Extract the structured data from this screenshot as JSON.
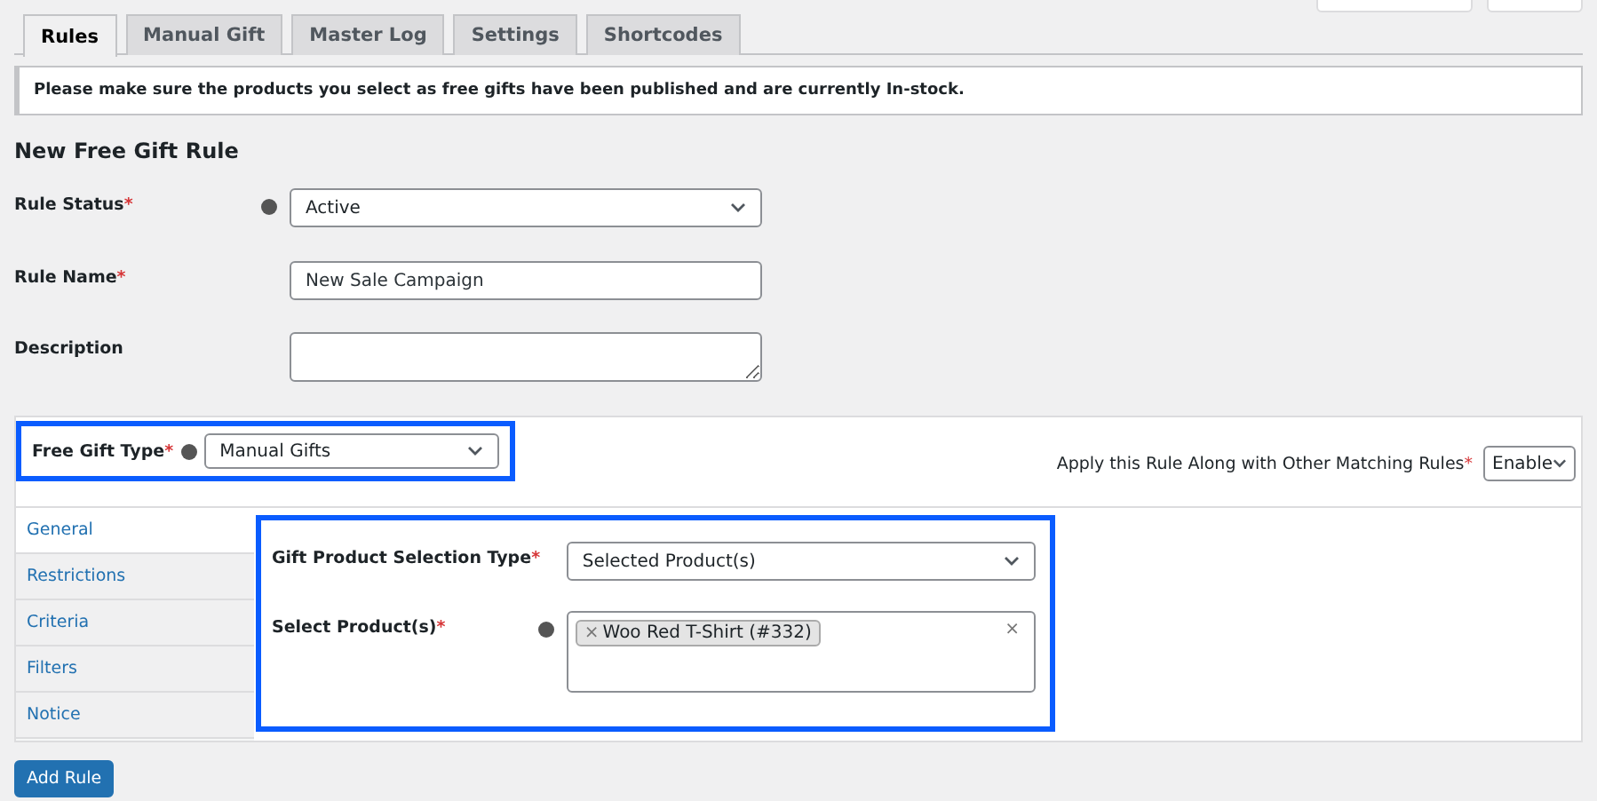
{
  "top_buttons": [
    {
      "kind": "cut"
    },
    {
      "kind": "cut"
    }
  ],
  "tabs": [
    {
      "label": "Rules",
      "selected": true
    },
    {
      "label": "Manual Gift",
      "selected": false
    },
    {
      "label": "Master Log",
      "selected": false
    },
    {
      "label": "Settings",
      "selected": false
    },
    {
      "label": "Shortcodes",
      "selected": false
    }
  ],
  "notice": "Please make sure the products you select as free gifts have been published and are currently In-stock.",
  "heading": "New Free Gift Rule",
  "fields": [
    {
      "label": "Rule Status",
      "required": true,
      "help": true,
      "kind": "select",
      "value": "Active"
    },
    {
      "label": "Rule Name",
      "required": true,
      "help": false,
      "kind": "text",
      "value": "New Sale Campaign"
    },
    {
      "label": "Description",
      "required": false,
      "help": false,
      "kind": "textarea"
    }
  ],
  "required_mark": "*",
  "gift_type": {
    "label": "Free Gift Type",
    "required": true,
    "value": "Manual Gifts",
    "highlighted": true
  },
  "apply_rule": {
    "label": "Apply this Rule Along with Other Matching Rules",
    "required": true,
    "value": "Enable"
  },
  "side_tabs": [
    {
      "label": "General",
      "selected": true
    },
    {
      "label": "Restrictions",
      "selected": false
    },
    {
      "label": "Criteria",
      "selected": false
    },
    {
      "label": "Filters",
      "selected": false
    },
    {
      "label": "Notice",
      "selected": false
    }
  ],
  "general": {
    "highlighted": true,
    "selection_type": {
      "label": "Gift Product Selection Type",
      "required": true,
      "value": "Selected Product(s)"
    },
    "products": {
      "label": "Select Product(s)",
      "required": true,
      "remove": "×",
      "clear": "×",
      "chips": [
        "Woo Red T-Shirt (#332)"
      ]
    }
  },
  "submit": "Add Rule"
}
